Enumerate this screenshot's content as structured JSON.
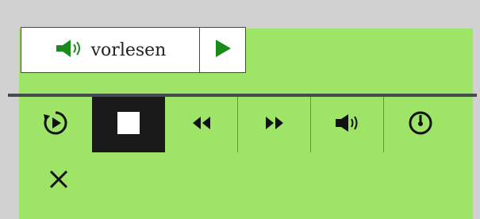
{
  "read_aloud": {
    "label": "vorlesen",
    "icon": "speaker-icon"
  },
  "play": {
    "icon": "play-icon"
  },
  "controls": [
    {
      "name": "replay",
      "icon": "replay-icon"
    },
    {
      "name": "stop",
      "icon": "stop-icon",
      "active": true
    },
    {
      "name": "rewind",
      "icon": "rewind-icon"
    },
    {
      "name": "fast-forward",
      "icon": "fast-forward-icon"
    },
    {
      "name": "volume",
      "icon": "volume-icon"
    },
    {
      "name": "speed",
      "icon": "speedometer-icon"
    }
  ],
  "close": {
    "icon": "close-icon"
  },
  "colors": {
    "panel": "#9ee467",
    "accent_green": "#1a8a1a",
    "active_bg": "#1a1a1a",
    "divider": "#444c50"
  }
}
